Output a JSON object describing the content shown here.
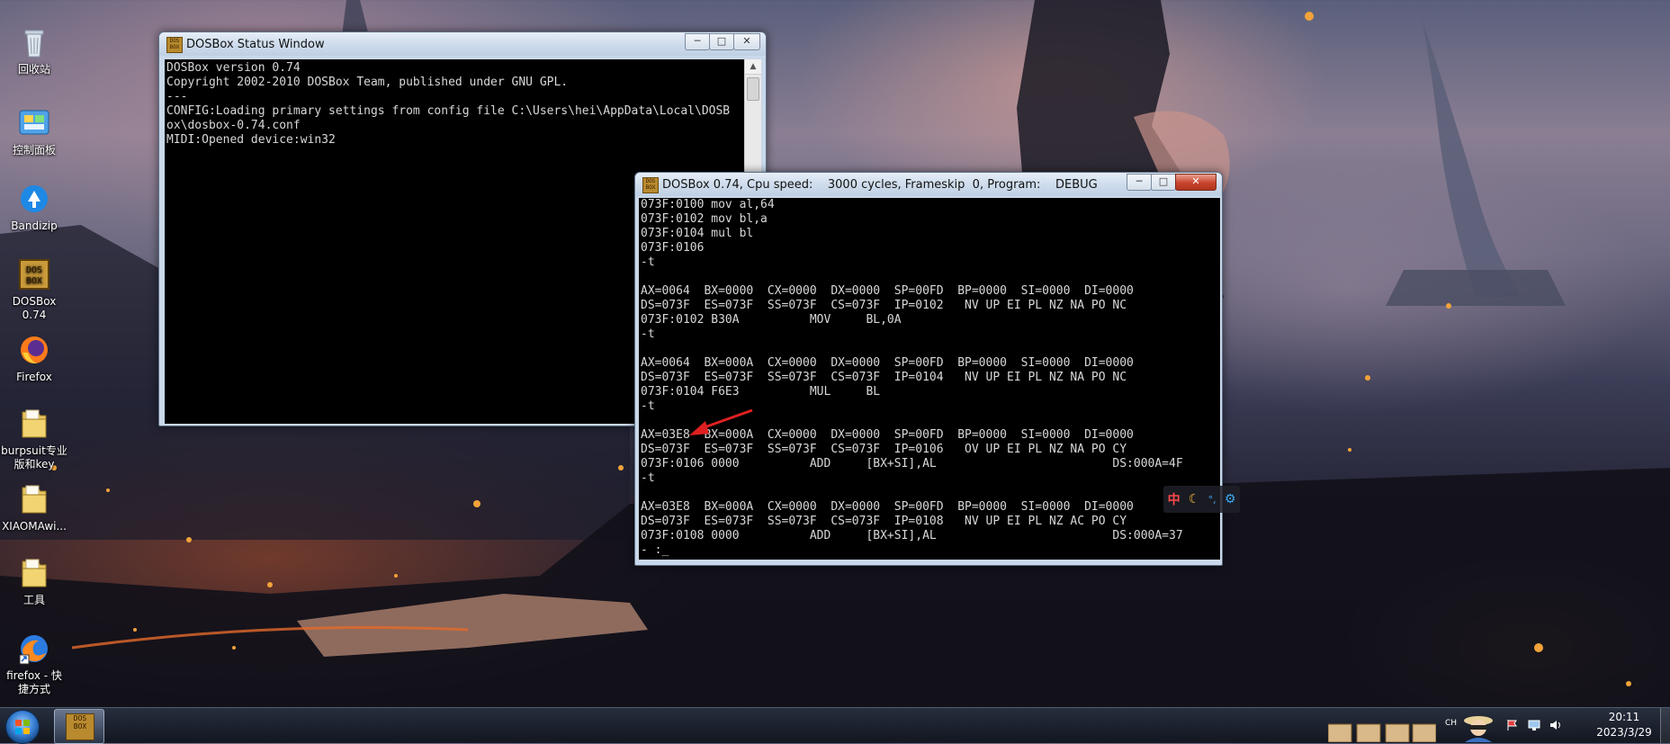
{
  "desktop": {
    "icons": [
      {
        "label": "回收站",
        "icon": "recycle-bin-icon"
      },
      {
        "label": "控制面板",
        "icon": "control-panel-icon"
      },
      {
        "label": "Bandizip",
        "icon": "bandizip-icon"
      },
      {
        "label": "DOSBox\n0.74",
        "icon": "dosbox-icon"
      },
      {
        "label": "Firefox",
        "icon": "firefox-icon"
      },
      {
        "label": "burpsuit专业\n版和key",
        "icon": "folder-icon"
      },
      {
        "label": "XIAOMAwi...",
        "icon": "folder-icon"
      },
      {
        "label": "工具",
        "icon": "folder-icon"
      },
      {
        "label": "firefox - 快\n捷方式",
        "icon": "firefox-shortcut-icon"
      }
    ]
  },
  "status_window": {
    "title": "DOSBox Status Window",
    "icon_text": "DOS BOX",
    "lines": "DOSBox version 0.74\nCopyright 2002-2010 DOSBox Team, published under GNU GPL.\n---\nCONFIG:Loading primary settings from config file C:\\Users\\hei\\AppData\\Local\\DOSB\nox\\dosbox-0.74.conf\nMIDI:Opened device:win32"
  },
  "debug_window": {
    "title": "DOSBox 0.74, Cpu speed:    3000 cycles, Frameskip  0, Program:    DEBUG",
    "icon_text": "DOS BOX",
    "lines": "073F:0100 mov al,64\n073F:0102 mov bl,a\n073F:0104 mul bl\n073F:0106\n-t\n\nAX=0064  BX=0000  CX=0000  DX=0000  SP=00FD  BP=0000  SI=0000  DI=0000\nDS=073F  ES=073F  SS=073F  CS=073F  IP=0102   NV UP EI PL NZ NA PO NC\n073F:0102 B30A          MOV     BL,0A\n-t\n\nAX=0064  BX=000A  CX=0000  DX=0000  SP=00FD  BP=0000  SI=0000  DI=0000\nDS=073F  ES=073F  SS=073F  CS=073F  IP=0104   NV UP EI PL NZ NA PO NC\n073F:0104 F6E3          MUL     BL\n-t\n\nAX=03E8  BX=000A  CX=0000  DX=0000  SP=00FD  BP=0000  SI=0000  DI=0000\nDS=073F  ES=073F  SS=073F  CS=073F  IP=0106   OV UP EI PL NZ NA PO CY\n073F:0106 0000          ADD     [BX+SI],AL                         DS:000A=4F\n-t\n\nAX=03E8  BX=000A  CX=0000  DX=0000  SP=00FD  BP=0000  SI=0000  DI=0000\nDS=073F  ES=073F  SS=073F  CS=073F  IP=0108   NV UP EI PL NZ AC PO CY\n073F:0108 0000          ADD     [BX+SI],AL                         DS:000A=37\n- :_"
  },
  "ime_bar": {
    "lang": "中",
    "moon": "☾",
    "punct": "°,",
    "gear": "⚙"
  },
  "window_controls": {
    "minimize": "─",
    "maximize": "□",
    "close": "✕"
  },
  "taskbar": {
    "task_icon_text": "DOS BOX",
    "clock_time": "20:11",
    "clock_date": "2023/3/29",
    "tray_text": "CH"
  },
  "colors": {
    "annotation_arrow": "#e02020",
    "console_bg": "#000000",
    "console_fg": "#d8d8d8"
  }
}
